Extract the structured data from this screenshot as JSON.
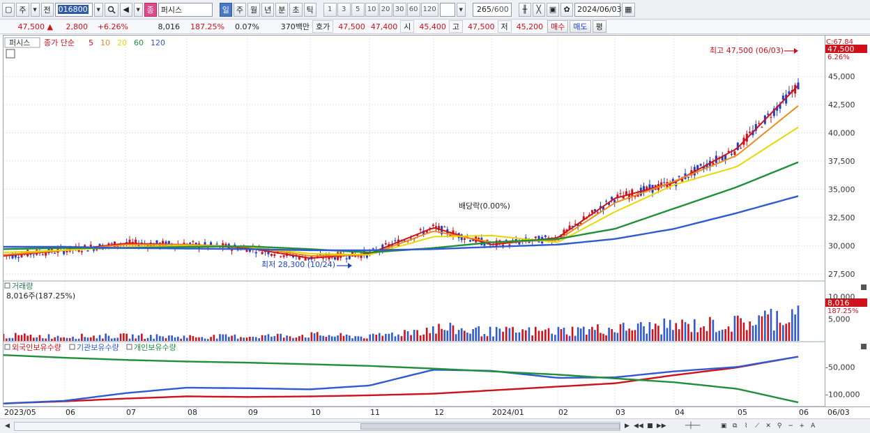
{
  "toolbar": {
    "market_type": "주",
    "period_label": "전",
    "stock_code": "016800",
    "stock_name": "퍼시스",
    "badge": "종",
    "interval_tabs": [
      "일",
      "주",
      "월",
      "년",
      "분",
      "초",
      "틱"
    ],
    "active_interval": "일",
    "step_buttons": [
      "1",
      "3",
      "5",
      "10",
      "20",
      "30",
      "60",
      "120"
    ],
    "count_value": "265",
    "count_total": "/600",
    "date": "2024/06/03"
  },
  "quote": {
    "price": "47,500",
    "change_arrow": "▲",
    "change": "2,800",
    "change_pct": "+6.26%",
    "volume": "8,016",
    "volume_ratio": "187.25%",
    "turnover": "0.07%",
    "amount": "370백만",
    "bid_label": "호가",
    "ask": "47,500",
    "bid": "47,400",
    "open_label": "시",
    "open": "45,400",
    "high_label": "고",
    "high": "47,500",
    "low_label": "저",
    "low": "45,200",
    "buy_label": "매수",
    "sell_label": "매도",
    "eval_label": "평"
  },
  "price_panel": {
    "title": "퍼시스",
    "legend_prefix": "종가 단순",
    "ma_legend": [
      {
        "period": "5",
        "color": "#d0101a"
      },
      {
        "period": "10",
        "color": "#f08a1c"
      },
      {
        "period": "20",
        "color": "#e8d800"
      },
      {
        "period": "60",
        "color": "#1f8f3a"
      },
      {
        "period": "120",
        "color": "#2f5ad0"
      }
    ],
    "high_annotation": "최고 47,500 (06/03)",
    "low_annotation": "최저 28,300 (10/24)",
    "dividend_annotation": "배당락(0.00%)",
    "current_price_tag": "47,500",
    "current_pct_tag": "6.26%",
    "corner_label": "C:67.84",
    "y_ticks": [
      "45,000",
      "42,500",
      "40,000",
      "37,500",
      "35,000",
      "32,500",
      "30,000",
      "27,500"
    ]
  },
  "volume_panel": {
    "title": "거래량",
    "value_label": "8,016주(187.25%)",
    "tag_value": "8,016",
    "tag_pct": "187.25%",
    "y_ticks": [
      "10,000",
      "5,000"
    ]
  },
  "holding_panel": {
    "legends": [
      {
        "label": "외국인보유수량",
        "color": "#d0101a"
      },
      {
        "label": "기관보유수량",
        "color": "#2f5ad0"
      },
      {
        "label": "개인보유수량",
        "color": "#1f8f3a"
      }
    ],
    "y_ticks": [
      "-50,000",
      "-100,000"
    ]
  },
  "x_axis": {
    "labels": [
      "2023/05",
      "06",
      "07",
      "08",
      "09",
      "10",
      "11",
      "12",
      "2024/01",
      "02",
      "03",
      "04",
      "05",
      "06"
    ],
    "right_label": "06/03"
  },
  "chart_data": [
    {
      "type": "line",
      "panel": "price",
      "x": [
        "2023/05",
        "06",
        "07",
        "08",
        "09",
        "10",
        "11",
        "12",
        "2024/01",
        "02",
        "03",
        "04",
        "05",
        "06/03"
      ],
      "ylim": [
        27000,
        48000
      ],
      "series": [
        {
          "name": "5",
          "values": [
            29100,
            29600,
            30200,
            30100,
            29800,
            28900,
            29300,
            31600,
            30100,
            30700,
            34200,
            35600,
            38600,
            44200
          ]
        },
        {
          "name": "10",
          "values": [
            29200,
            29600,
            30100,
            30100,
            29900,
            29100,
            29200,
            31300,
            30300,
            30500,
            33800,
            35700,
            38000,
            42400
          ]
        },
        {
          "name": "20",
          "values": [
            29400,
            29600,
            29900,
            30000,
            29900,
            29300,
            29200,
            30800,
            30900,
            30300,
            33000,
            35400,
            37000,
            40500
          ]
        },
        {
          "name": "60",
          "values": [
            29700,
            29800,
            29800,
            29900,
            29950,
            29700,
            29400,
            29800,
            30300,
            30600,
            31500,
            33300,
            35200,
            37400
          ]
        },
        {
          "name": "120",
          "values": [
            29900,
            29900,
            29800,
            29750,
            29700,
            29600,
            29600,
            29700,
            29900,
            30100,
            30600,
            31500,
            32900,
            34400
          ]
        }
      ],
      "annotations": [
        {
          "text": "최고 47,500 (06/03)",
          "x": "06/03",
          "y": 47500
        },
        {
          "text": "최저 28,300 (10/24)",
          "x": "10/24",
          "y": 28300
        },
        {
          "text": "배당락(0.00%)",
          "x": "12/27",
          "y": 32900
        }
      ]
    },
    {
      "type": "bar",
      "panel": "volume",
      "categories": [
        "2023/05",
        "06",
        "07",
        "08",
        "09",
        "10",
        "11",
        "12",
        "2024/01",
        "02",
        "03",
        "04",
        "05",
        "06"
      ],
      "values": [
        1500,
        1300,
        1400,
        1200,
        1300,
        1700,
        1200,
        3600,
        2600,
        2800,
        3400,
        4200,
        4800,
        8016
      ],
      "ylim": [
        0,
        12000
      ]
    },
    {
      "type": "line",
      "panel": "holding",
      "x": [
        "2023/05",
        "06",
        "07",
        "08",
        "09",
        "10",
        "11",
        "12",
        "2024/01",
        "02",
        "03",
        "04",
        "05",
        "06"
      ],
      "ylim": [
        -120000,
        -15000
      ],
      "series": [
        {
          "name": "외국인보유수량",
          "values": [
            -117000,
            -113000,
            -108000,
            -104000,
            -105000,
            -104000,
            -102000,
            -99000,
            -93000,
            -86000,
            -80000,
            -65000,
            -51000,
            -31000
          ]
        },
        {
          "name": "기관보유수량",
          "values": [
            -117000,
            -112000,
            -98000,
            -88000,
            -89000,
            -91000,
            -84000,
            -55000,
            -57000,
            -70000,
            -69000,
            -58000,
            -50000,
            -31000
          ]
        },
        {
          "name": "개인보유수량",
          "values": [
            -28000,
            -33000,
            -37000,
            -40000,
            -42000,
            -45000,
            -48000,
            -53000,
            -58000,
            -64000,
            -71000,
            -78000,
            -90000,
            -115000
          ]
        }
      ]
    }
  ]
}
